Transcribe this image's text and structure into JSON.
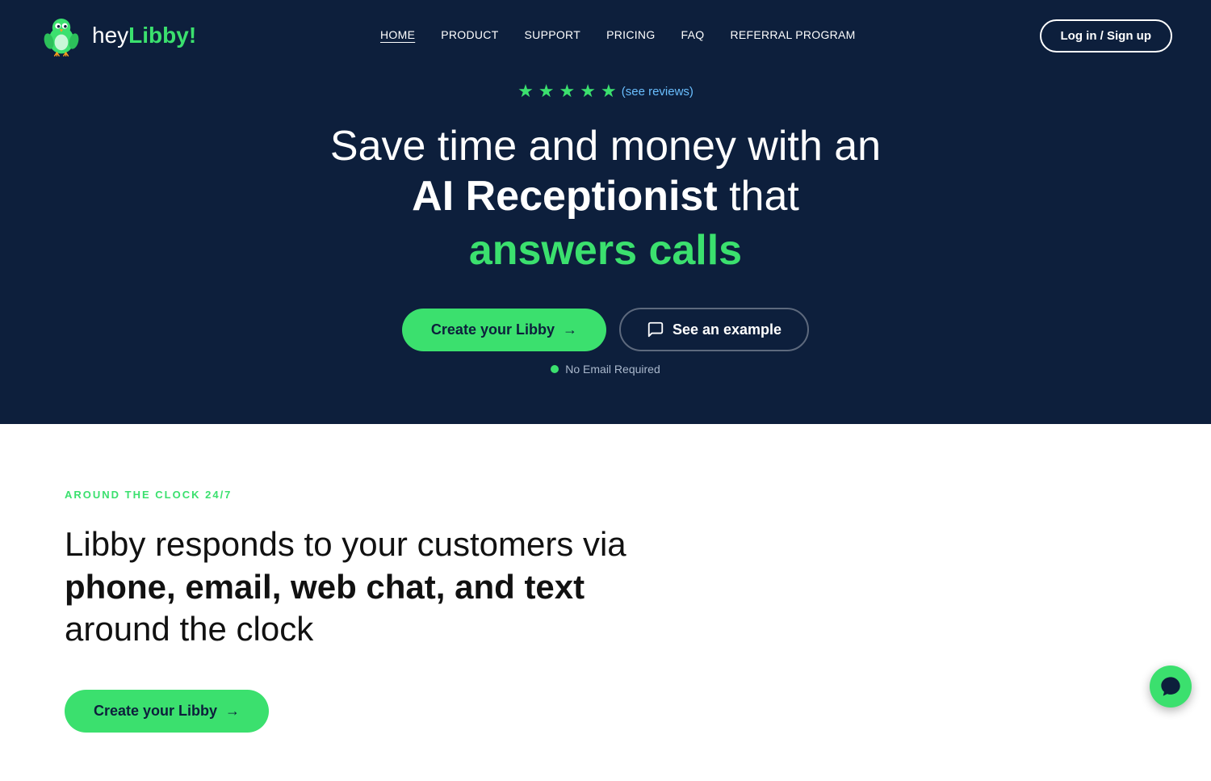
{
  "nav": {
    "logo_text_hey": "hey",
    "logo_text_libby": "Libby!",
    "links": [
      {
        "label": "HOME",
        "active": true,
        "href": "#"
      },
      {
        "label": "PRODUCT",
        "active": false,
        "href": "#"
      },
      {
        "label": "SUPPORT",
        "active": false,
        "href": "#"
      },
      {
        "label": "PRICING",
        "active": false,
        "href": "#"
      },
      {
        "label": "FAQ",
        "active": false,
        "href": "#"
      },
      {
        "label": "REFERRAL PROGRAM",
        "active": false,
        "href": "#"
      }
    ],
    "login_label": "Log in / Sign up"
  },
  "hero": {
    "reviews_text": "(see reviews)",
    "title_line1": "Save time and money with an",
    "title_bold": "AI Receptionist",
    "title_that": " that",
    "title_green": "answers calls",
    "cta_primary": "Create your Libby",
    "cta_secondary": "See an example",
    "no_email": "No Email Required"
  },
  "section2": {
    "tag": "AROUND THE CLOCK 24/7",
    "title_line1": "Libby responds to your customers via",
    "title_bold": "phone, email, web chat, and text",
    "title_line3": "around the clock",
    "cta_label": "Create your Libby"
  }
}
